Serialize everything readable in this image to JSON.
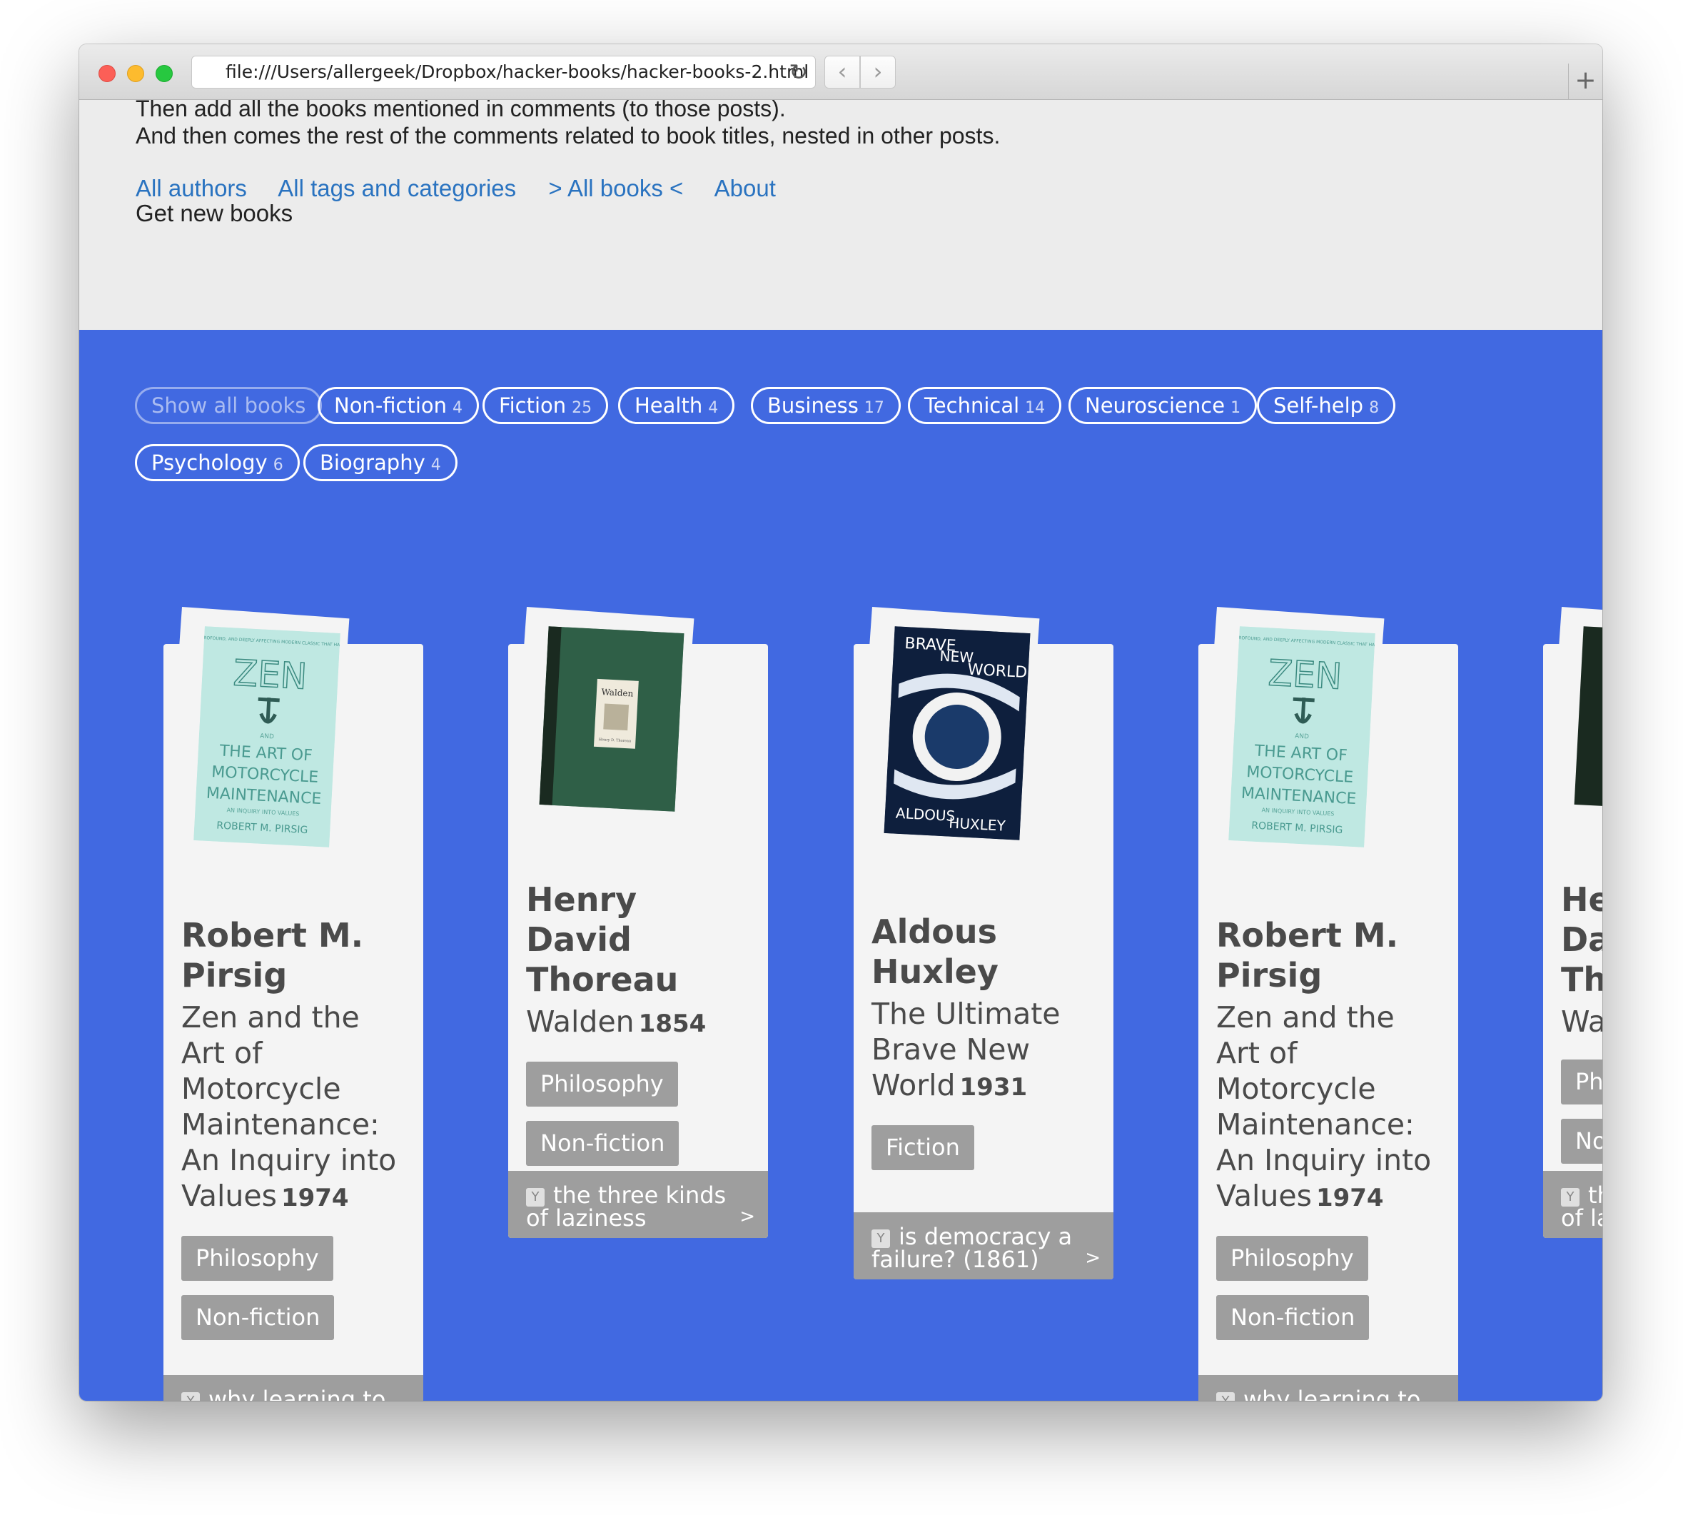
{
  "browser": {
    "url": "file:///Users/allergeek/Dropbox/hacker-books/hacker-books-2.html",
    "reload_icon": "↻",
    "back_icon": "‹",
    "forward_icon": "›",
    "newtab_icon": "+"
  },
  "intro": {
    "line1": "Then add all the books mentioned in comments (to those posts).",
    "line2": "And then comes the rest of the comments related to book titles, nested in other posts."
  },
  "nav": {
    "authors": "All authors",
    "tags": "All tags and categories",
    "books": "> All books <",
    "about": "About",
    "get_new": "Get new books"
  },
  "filters": [
    {
      "label": "Show all books",
      "count": ""
    },
    {
      "label": "Non-fiction",
      "count": "4"
    },
    {
      "label": "Fiction",
      "count": "25"
    },
    {
      "label": "Health",
      "count": "4"
    },
    {
      "label": "Business",
      "count": "17"
    },
    {
      "label": "Technical",
      "count": "14"
    },
    {
      "label": "Neuroscience",
      "count": "1"
    },
    {
      "label": "Self-help",
      "count": "8"
    },
    {
      "label": "Psychology",
      "count": "6"
    },
    {
      "label": "Biography",
      "count": "4"
    }
  ],
  "books": [
    {
      "author": "Robert M. Pirsig",
      "title": "Zen and the Art of Motorcycle Maintenance: An Inquiry into Values",
      "year": "1974",
      "tags": [
        "Philosophy",
        "Non-fiction"
      ],
      "comment_icon": "Y",
      "comment": "why learning to code is so damn hard",
      "arrow": ">",
      "cover": {
        "text1": "ZEN",
        "text2": "AND",
        "text3": "THE ART OF MOTORCYCLE MAINTENANCE",
        "text4": "AN INQUIRY INTO VALUES",
        "text5": "ROBERT M. PIRSIG",
        "tagline": "THE PROVOCATIVE, PROFOUND, AND DEEPLY AFFECTING MODERN CLASSIC THAT HAS INSPIRED MILLIONS"
      }
    },
    {
      "author": "Henry David Thoreau",
      "title": "Walden",
      "year": "1854",
      "tags": [
        "Philosophy",
        "Non-fiction"
      ],
      "comment_icon": "Y",
      "comment": "the three kinds of laziness",
      "arrow": ">",
      "cover": {
        "text1": "Walden",
        "text2": "Henry D. Thoreau"
      }
    },
    {
      "author": "Aldous Huxley",
      "title": "The Ultimate Brave New World",
      "year": "1931",
      "tags": [
        "Fiction"
      ],
      "comment_icon": "Y",
      "comment": "is democracy a failure? (1861)",
      "arrow": ">",
      "cover": {
        "text1": "BRAVE",
        "text2": "NEW",
        "text3": "WORLD",
        "text4": "ALDOUS",
        "text5": "HUXLEY"
      }
    },
    {
      "author": "Robert M. Pirsig",
      "title": "Zen and the Art of Motorcycle Maintenance: An Inquiry into Values",
      "year": "1974",
      "tags": [
        "Philosophy",
        "Non-fiction"
      ],
      "comment_icon": "Y",
      "comment": "why learning to code is so damn hard",
      "arrow": ">",
      "cover": {
        "text1": "ZEN",
        "text2": "AND",
        "text3": "THE ART OF MOTORCYCLE MAINTENANCE",
        "text4": "AN INQUIRY INTO VALUES",
        "text5": "ROBERT M. PIRSIG",
        "tagline": "THE PROVOCATIVE, PROFOUND, AND DEEPLY AFFECTING MODERN CLASSIC THAT HAS INSPIRED MILLIONS"
      }
    },
    {
      "author": "Henry David Thoreau",
      "title": "Walden",
      "tags": [
        "Philosophy",
        "Non-fiction"
      ],
      "comment_icon": "Y",
      "comment": "the three kinds of laziness"
    }
  ],
  "colors": {
    "page_bg": "#ececec",
    "blue": "#4169e1",
    "link": "#2a73c0",
    "tag": "#9e9e9e",
    "card": "#f4f4f4"
  }
}
